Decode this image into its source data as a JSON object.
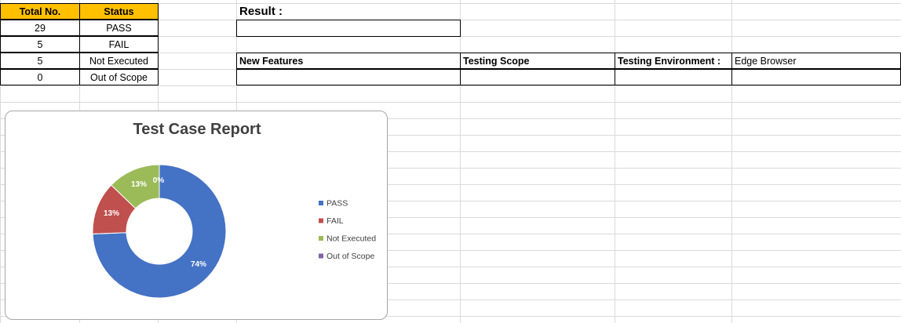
{
  "summary_table": {
    "headers": [
      "Total No.",
      "Status"
    ],
    "rows": [
      {
        "count": "29",
        "status": "PASS"
      },
      {
        "count": "5",
        "status": "FAIL"
      },
      {
        "count": "5",
        "status": "Not Executed"
      },
      {
        "count": "0",
        "status": "Out of Scope"
      }
    ]
  },
  "result_label": "Result :",
  "info_row": {
    "new_features": "New Features",
    "testing_scope": "Testing Scope",
    "testing_environment": "Testing Environment :",
    "environment_value": "Edge Browser"
  },
  "colors": {
    "header_fill": "#ffc000"
  },
  "chart_data": {
    "type": "pie",
    "variant": "doughnut",
    "title": "Test Case Report",
    "categories": [
      "PASS",
      "FAIL",
      "Not Executed",
      "Out of Scope"
    ],
    "values": [
      29,
      5,
      5,
      0
    ],
    "labels": [
      "74%",
      "13%",
      "13%",
      "0%"
    ],
    "colors": [
      "#4472c4",
      "#c0504d",
      "#9bbb59",
      "#8064a2"
    ],
    "legend": "right"
  }
}
